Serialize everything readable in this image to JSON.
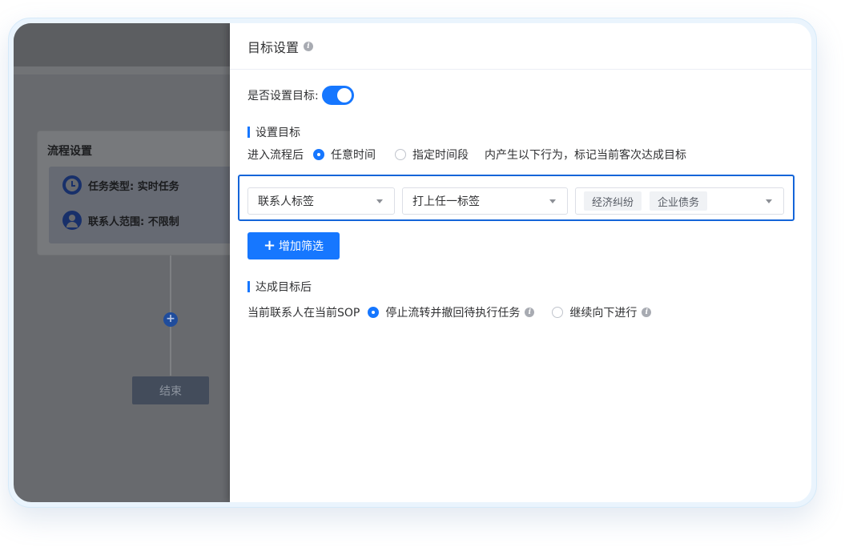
{
  "background": {
    "card_title": "流程设置",
    "task_type": "任务类型: 实时任务",
    "contact_scope": "联系人范围: 不限制",
    "add_node": "+",
    "end_node": "结束"
  },
  "drawer": {
    "title": "目标设置",
    "set_goal_label": "是否设置目标:",
    "set_goal_enabled": true,
    "section1_title": "设置目标",
    "condition_prefix": "进入流程后",
    "condition_options": [
      "任意时间",
      "指定时间段"
    ],
    "condition_selected": "任意时间",
    "condition_suffix": "内产生以下行为，标记当前客次达成目标",
    "filter": {
      "field": "联系人标签",
      "operator": "打上任一标签",
      "tags": [
        "经济纠纷",
        "企业债务"
      ]
    },
    "add_filter": "增加筛选",
    "section2_title": "达成目标后",
    "after_prefix": "当前联系人在当前SOP",
    "after_options": [
      "停止流转并撤回待执行任务",
      "继续向下进行"
    ],
    "after_selected": "停止流转并撤回待执行任务"
  },
  "icons": {
    "info": "info-icon",
    "clock": "clock-icon",
    "user": "user-icon",
    "caret": "caret-down-icon",
    "plus": "plus-icon"
  },
  "colors": {
    "primary": "#1677ff",
    "highlight_border": "#1465d9",
    "overlay": "#686a6e"
  }
}
